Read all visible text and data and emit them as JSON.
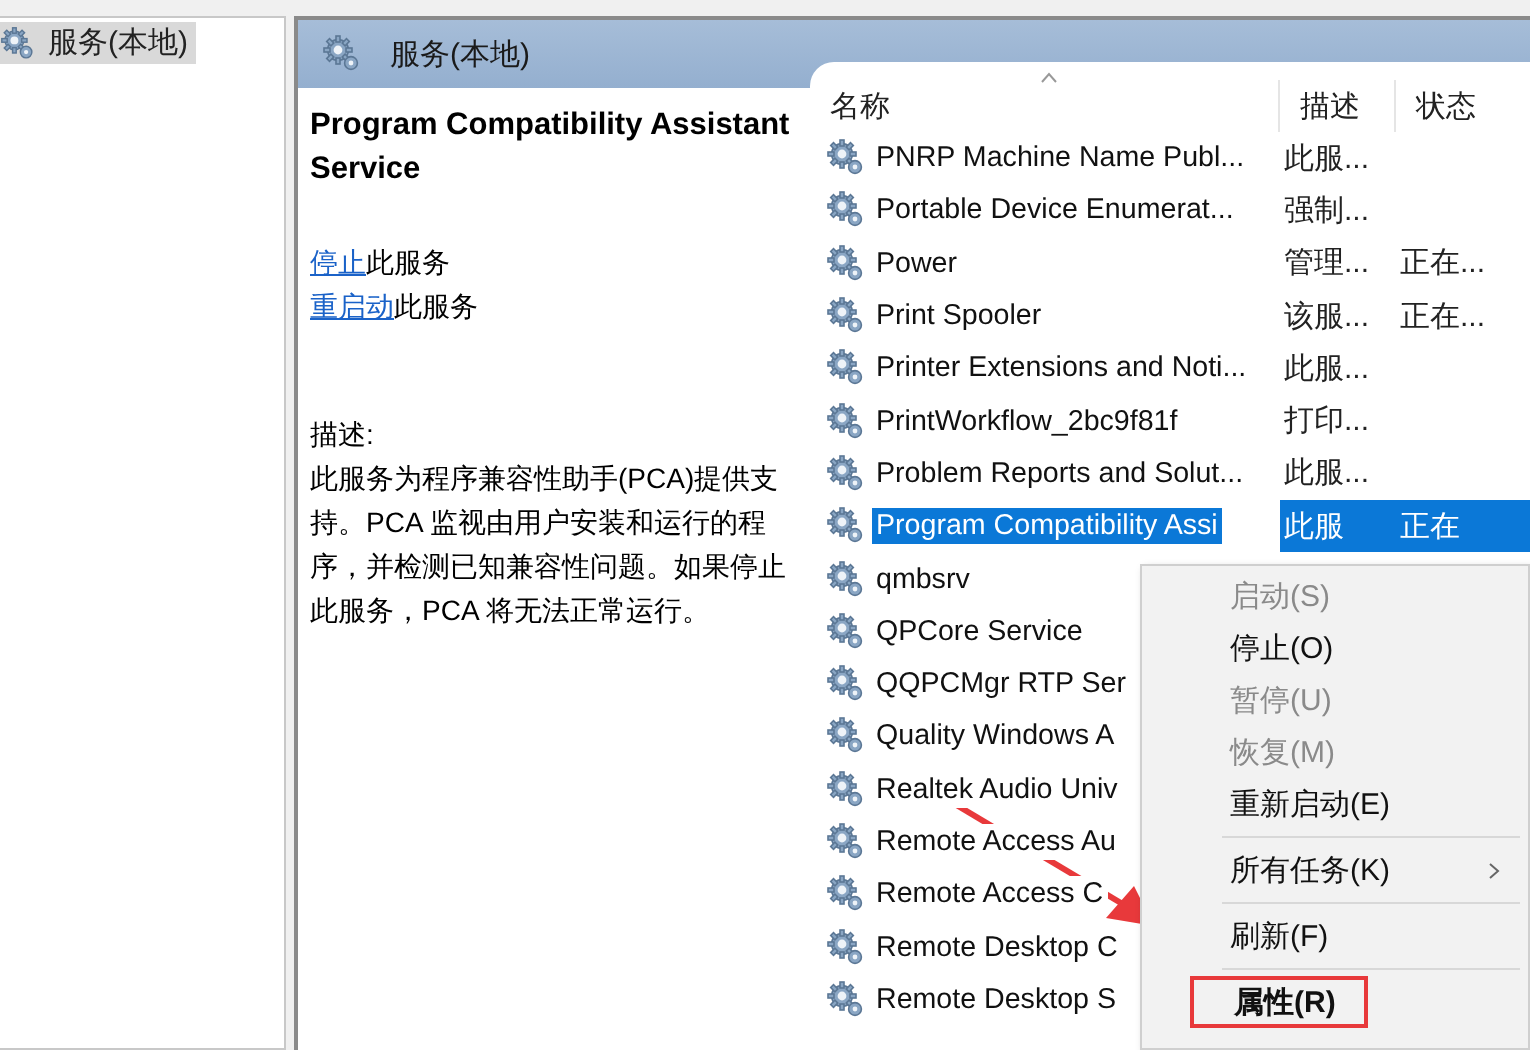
{
  "tree": {
    "items": [
      {
        "label": "服务(本地)",
        "selected": true
      }
    ]
  },
  "header": {
    "title": "服务(本地)"
  },
  "detail": {
    "title": "Program Compatibility Assistant Service",
    "actions": [
      {
        "link": "停止",
        "text": "此服务"
      },
      {
        "link": "重启动",
        "text": "此服务"
      }
    ],
    "description_label": "描述:",
    "description": "此服务为程序兼容性助手(PCA)提供支持。PCA 监视由用户安装和运行的程序，并检测已知兼容性问题。如果停止此服务，PCA 将无法正常运行。"
  },
  "table": {
    "columns": [
      "名称",
      "描述",
      "状态"
    ],
    "rows": [
      {
        "name": "PNRP Machine Name Publ...",
        "description": "此服...",
        "selected": false
      },
      {
        "name": "Portable Device Enumerat...",
        "description": "强制...",
        "selected": false
      },
      {
        "name": "Power",
        "description": "管理...",
        "status": "正在...",
        "selected": false
      },
      {
        "name": "Print Spooler",
        "description": "该服...",
        "status": "正在...",
        "selected": false
      },
      {
        "name": "Printer Extensions and Noti...",
        "description": "此服...",
        "selected": false
      },
      {
        "name": "PrintWorkflow_2bc9f81f",
        "description": "打印...",
        "selected": false
      },
      {
        "name": "Problem Reports and Solut...",
        "description": "此服...",
        "selected": false
      },
      {
        "name": "Program Compatibility Assi",
        "description": "此服",
        "status": "正在",
        "selected": true
      },
      {
        "name": "qmbsrv",
        "selected": false
      },
      {
        "name": "QPCore Service",
        "selected": false
      },
      {
        "name": "QQPCMgr RTP Ser",
        "selected": false
      },
      {
        "name": "Quality Windows A",
        "selected": false
      },
      {
        "name": "Realtek Audio Univ",
        "selected": false
      },
      {
        "name": "Remote Access Au",
        "selected": false
      },
      {
        "name": "Remote Access C",
        "selected": false
      },
      {
        "name": "Remote Desktop C",
        "selected": false
      },
      {
        "name": "Remote Desktop S",
        "selected": false
      }
    ]
  },
  "context_menu": {
    "items": [
      {
        "kind": "item",
        "label": "启动(S)",
        "disabled": true
      },
      {
        "kind": "item",
        "label": "停止(O)",
        "disabled": false
      },
      {
        "kind": "item",
        "label": "暂停(U)",
        "disabled": true
      },
      {
        "kind": "item",
        "label": "恢复(M)",
        "disabled": true
      },
      {
        "kind": "item",
        "label": "重新启动(E)",
        "disabled": false
      },
      {
        "kind": "separator"
      },
      {
        "kind": "item",
        "label": "所有任务(K)",
        "disabled": false,
        "submenu": true
      },
      {
        "kind": "separator"
      },
      {
        "kind": "item",
        "label": "刷新(F)",
        "disabled": false
      },
      {
        "kind": "separator"
      },
      {
        "kind": "item",
        "label": "属性(R)",
        "disabled": false,
        "default": true,
        "highlighted": true
      }
    ]
  },
  "annotation": {
    "arrow": true
  }
}
